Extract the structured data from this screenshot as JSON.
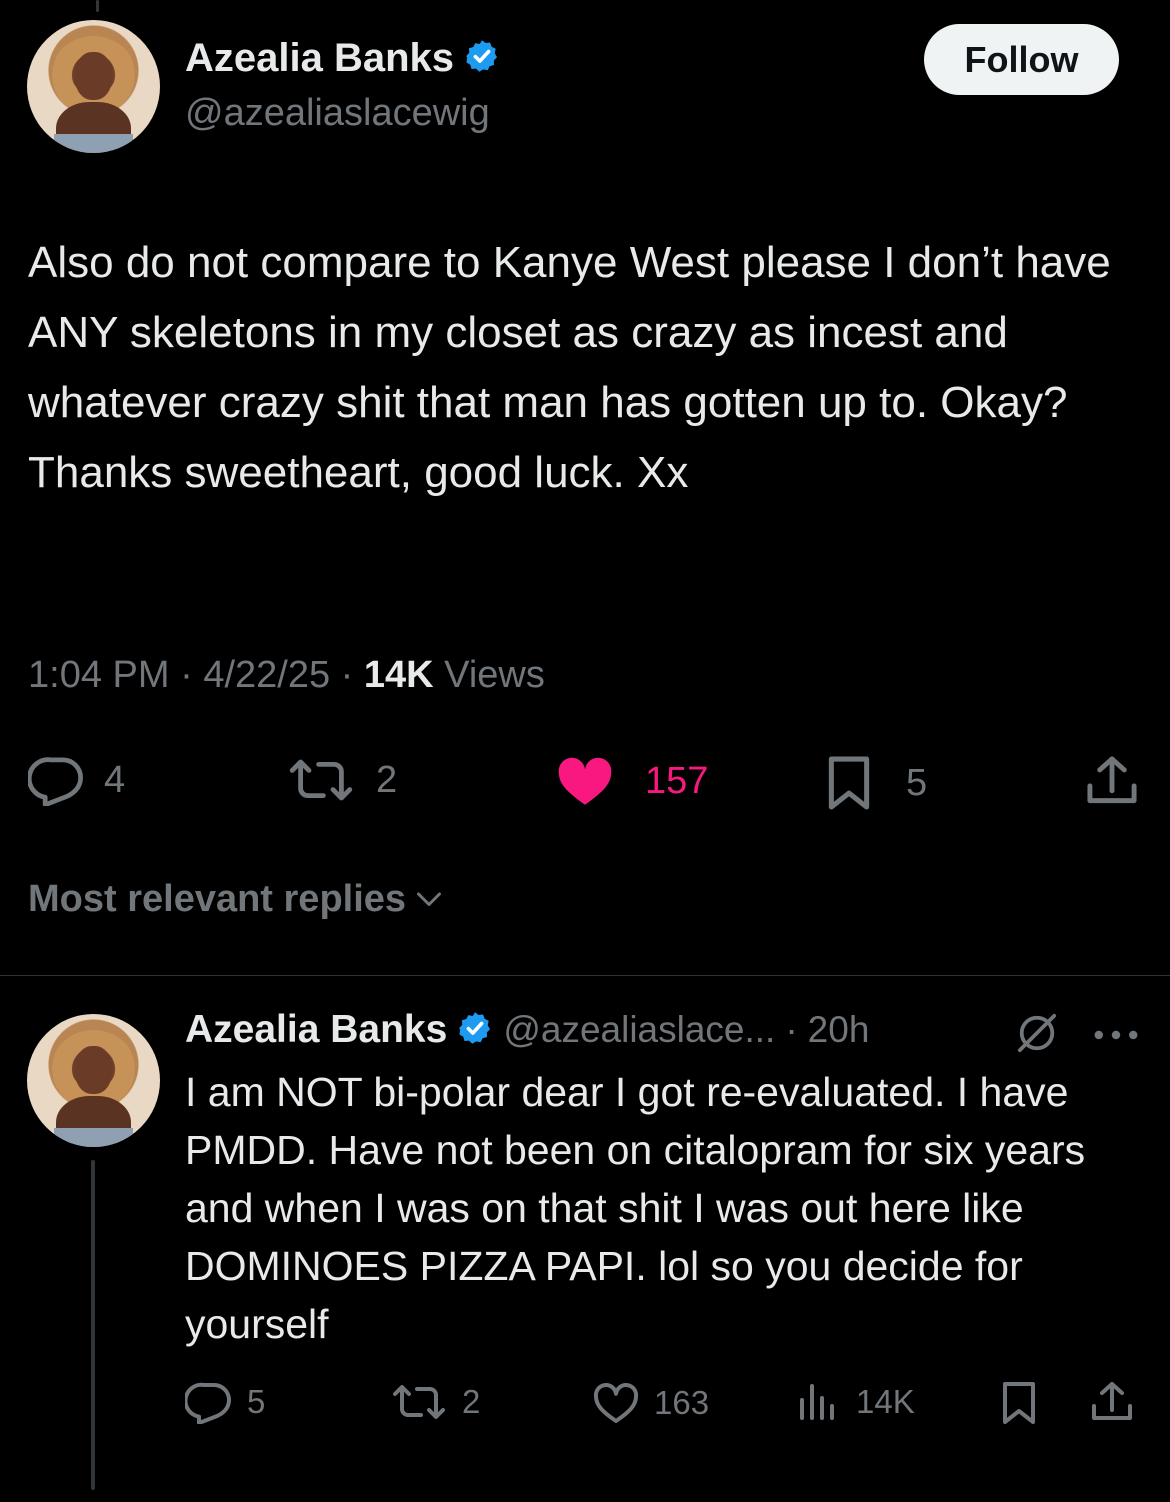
{
  "tweet": {
    "author_name": "Azealia Banks",
    "author_handle": "@azealiaslacewig",
    "follow_label": "Follow",
    "text": "Also do not compare to Kanye West please I don’t have ANY skeletons in my closet as crazy as incest and whatever crazy shit that man has gotten up to. Okay? Thanks sweetheart, good luck. Xx",
    "time": "1:04 PM",
    "date": "4/22/25",
    "views_count": "14K",
    "views_label": "Views",
    "separator": "·",
    "actions": {
      "reply_count": "4",
      "repost_count": "2",
      "like_count": "157",
      "bookmark_count": "5"
    }
  },
  "replies_header": {
    "label": "Most relevant replies"
  },
  "reply": {
    "author_name": "Azealia Banks",
    "author_handle": "@azealiaslace...",
    "separator": "·",
    "age": "20h",
    "text": "I am NOT bi-polar dear I got re-evaluated. I have PMDD. Have not been on citalopram for six years and when I was on that shit I was out here like DOMINOES PIZZA PAPI. lol so you decide for yourself",
    "actions": {
      "reply_count": "5",
      "repost_count": "2",
      "like_count": "163",
      "views_count": "14K"
    }
  },
  "colors": {
    "background": "#000000",
    "text": "#e7e9ea",
    "secondary": "#71767b",
    "like_active": "#f91880",
    "verified": "#1d9bf0"
  }
}
